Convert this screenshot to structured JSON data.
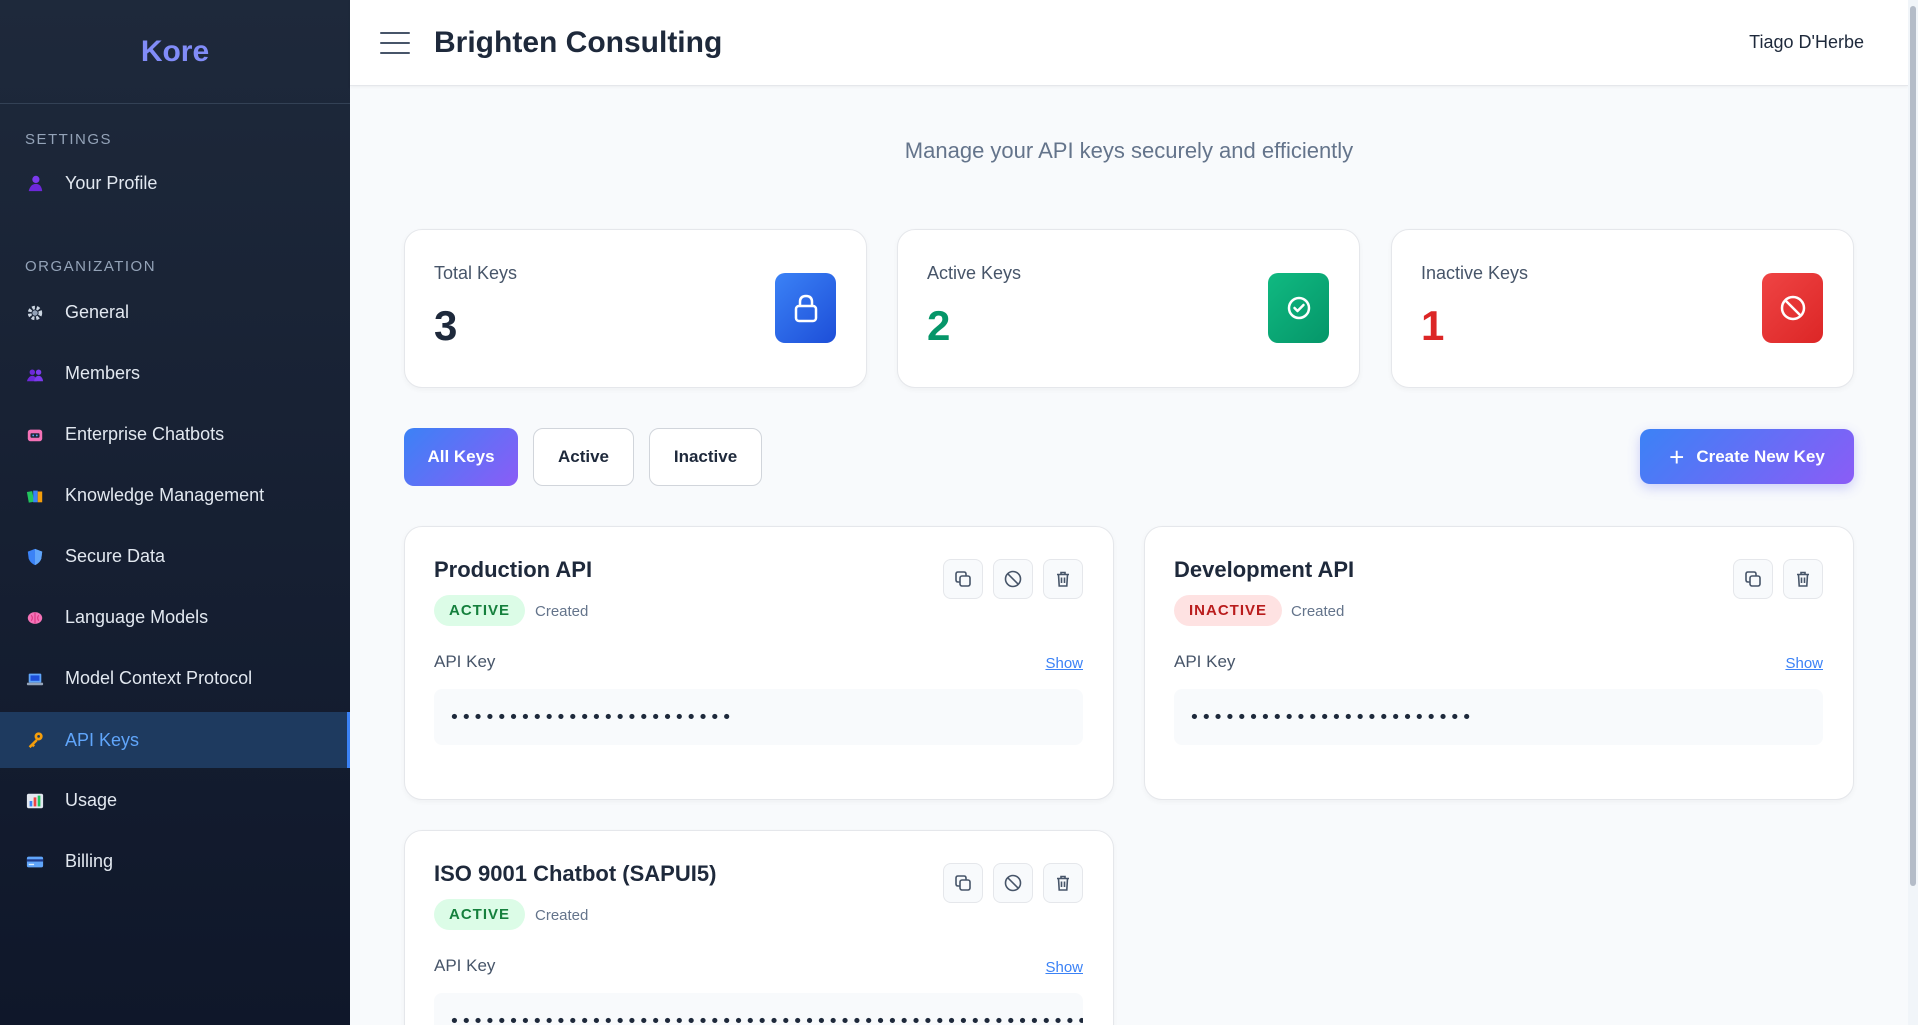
{
  "sidebar": {
    "brand": "Kore",
    "settings_title": "SETTINGS",
    "settings_items": [
      {
        "label": "Your Profile",
        "icon": "user-icon"
      }
    ],
    "org_title": "ORGANIZATION",
    "org_items": [
      {
        "label": "General",
        "icon": "gear-icon"
      },
      {
        "label": "Members",
        "icon": "members-icon"
      },
      {
        "label": "Enterprise Chatbots",
        "icon": "chatbot-icon"
      },
      {
        "label": "Knowledge Management",
        "icon": "books-icon"
      },
      {
        "label": "Secure Data",
        "icon": "shield-icon"
      },
      {
        "label": "Language Models",
        "icon": "brain-icon"
      },
      {
        "label": "Model Context Protocol",
        "icon": "laptop-icon"
      },
      {
        "label": "API Keys",
        "icon": "key-icon",
        "active": true
      },
      {
        "label": "Usage",
        "icon": "chart-icon"
      },
      {
        "label": "Billing",
        "icon": "credit-card-icon"
      }
    ]
  },
  "header": {
    "title": "Brighten Consulting",
    "user": "Tiago D'Herbe"
  },
  "main": {
    "subtitle": "Manage your API keys securely and efficiently",
    "stats": [
      {
        "label": "Total Keys",
        "value": "3",
        "color": "#1e293b",
        "icon": "lock-icon",
        "icon_bg": "#2563eb"
      },
      {
        "label": "Active Keys",
        "value": "2",
        "color": "#059669",
        "icon": "check-circle-icon",
        "icon_bg": "#10b981"
      },
      {
        "label": "Inactive Keys",
        "value": "1",
        "color": "#dc2626",
        "icon": "ban-icon",
        "icon_bg": "#ef4444"
      }
    ],
    "filters": [
      "All Keys",
      "Active",
      "Inactive"
    ],
    "active_filter": "All Keys",
    "create_button": "Create New Key",
    "keys": [
      {
        "name": "Production API",
        "status": "ACTIVE",
        "created": "Created",
        "field_label": "API Key",
        "show": "Show",
        "masked": "••••••••••••••••••••••••"
      },
      {
        "name": "Development API",
        "status": "INACTIVE",
        "created": "Created",
        "field_label": "API Key",
        "show": "Show",
        "masked": "••••••••••••••••••••••••"
      },
      {
        "name": "ISO 9001 Chatbot (SAPUI5)",
        "status": "ACTIVE",
        "created": "Created",
        "field_label": "API Key",
        "show": "Show",
        "masked": "•••••••••••••••••••••••••••••••••••••••••••••••••••••••••••••••••"
      }
    ]
  },
  "colors": {
    "accent": "#3b82f6",
    "accent2": "#8b5cf6",
    "sidebar_bg": "#1e293b"
  }
}
